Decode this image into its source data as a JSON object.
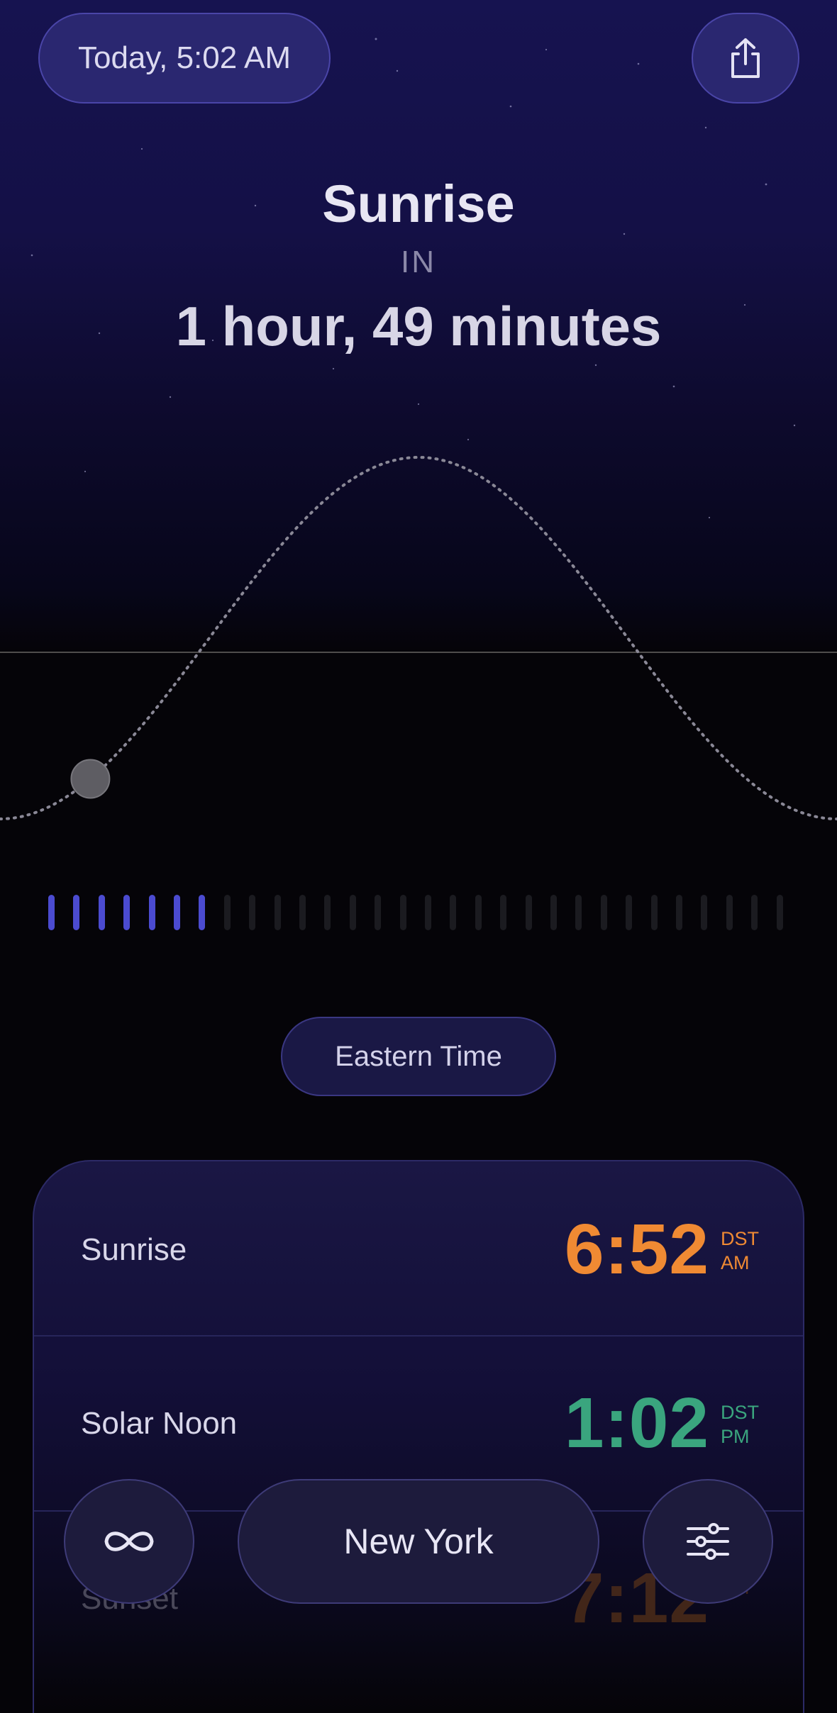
{
  "header": {
    "date_label": "Today, 5:02 AM",
    "share_icon": "share-icon"
  },
  "headline": {
    "event": "Sunrise",
    "connector": "IN",
    "countdown": "1 hour, 49 minutes"
  },
  "sun_path": {
    "current_progress": 0.108
  },
  "hour_ticks": {
    "total": 30,
    "active": 7,
    "active_color": "#4b4bd0",
    "inactive_color": "#1b1b20"
  },
  "timezone": {
    "label": "Eastern Time"
  },
  "times": [
    {
      "label": "Sunrise",
      "time": "6:52",
      "suffix_top": "DST",
      "suffix_bottom": "AM",
      "color": "#f08a33"
    },
    {
      "label": "Solar Noon",
      "time": "1:02",
      "suffix_top": "DST",
      "suffix_bottom": "PM",
      "color": "#3aa57e"
    },
    {
      "label": "Sunset",
      "time": "7:12",
      "suffix_top": "",
      "suffix_bottom": "PM",
      "color": "#7a4417"
    }
  ],
  "bottom_bar": {
    "loop_icon": "infinity-icon",
    "city": "New York",
    "settings_icon": "sliders-icon"
  },
  "colors": {
    "sky_top": "#161350",
    "accent_border": "#4a45a8",
    "background": "#050408"
  }
}
